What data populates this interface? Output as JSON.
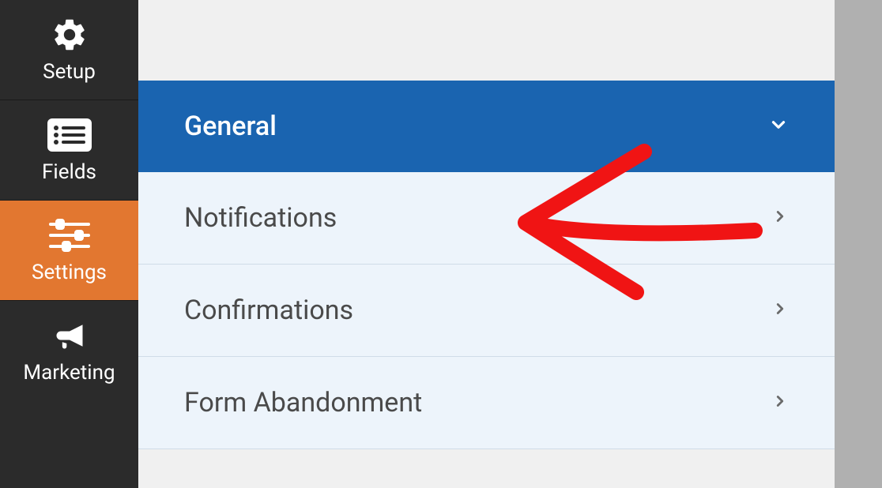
{
  "sidebar": {
    "items": [
      {
        "label": "Setup",
        "icon": "gear"
      },
      {
        "label": "Fields",
        "icon": "list"
      },
      {
        "label": "Settings",
        "icon": "sliders"
      },
      {
        "label": "Marketing",
        "icon": "megaphone"
      }
    ]
  },
  "panel": {
    "header": "General",
    "rows": [
      {
        "label": "Notifications"
      },
      {
        "label": "Confirmations"
      },
      {
        "label": "Form Abandonment"
      }
    ]
  }
}
